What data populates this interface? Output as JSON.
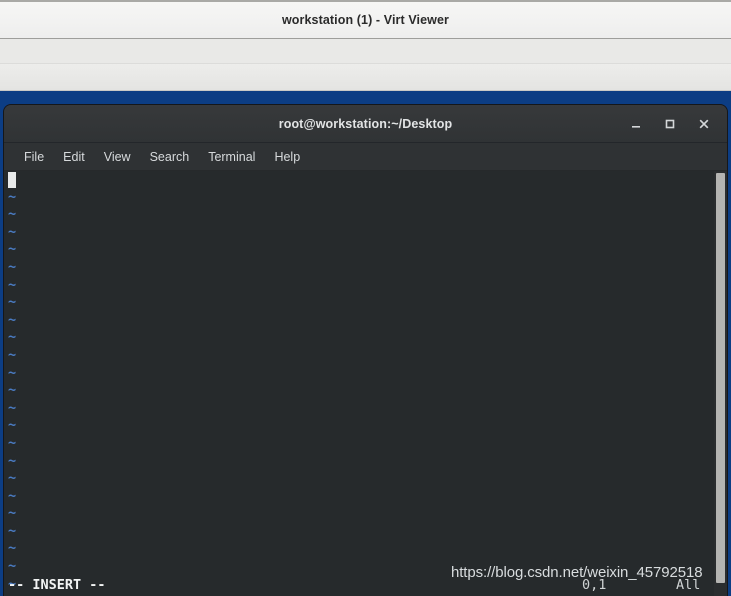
{
  "virt_viewer": {
    "window_title": "workstation (1) - Virt Viewer"
  },
  "terminal": {
    "window_title": "root@workstation:~/Desktop",
    "window_controls": [
      {
        "name": "minimize",
        "glyph": "_"
      },
      {
        "name": "maximize",
        "glyph": "□"
      },
      {
        "name": "close",
        "glyph": "×"
      }
    ],
    "menu": [
      {
        "label": "File"
      },
      {
        "label": "Edit"
      },
      {
        "label": "View"
      },
      {
        "label": "Search"
      },
      {
        "label": "Terminal"
      },
      {
        "label": "Help"
      }
    ]
  },
  "vim": {
    "empty_line_marker": "~",
    "empty_line_count": 23,
    "mode_text": "-- INSERT --",
    "ruler_position": "0,1",
    "ruler_scroll": "All",
    "cursor": {
      "line": 1,
      "column": 1
    }
  },
  "watermark": {
    "text": "https://blog.csdn.net/weixin_45792518"
  },
  "colors": {
    "vm_desktop_blue": "#0c3d84",
    "terminal_background": "#262a2c",
    "terminal_chrome": "#2f3234",
    "tilde_blue": "#4a7cc4",
    "cursor_white": "#e8eaea"
  }
}
